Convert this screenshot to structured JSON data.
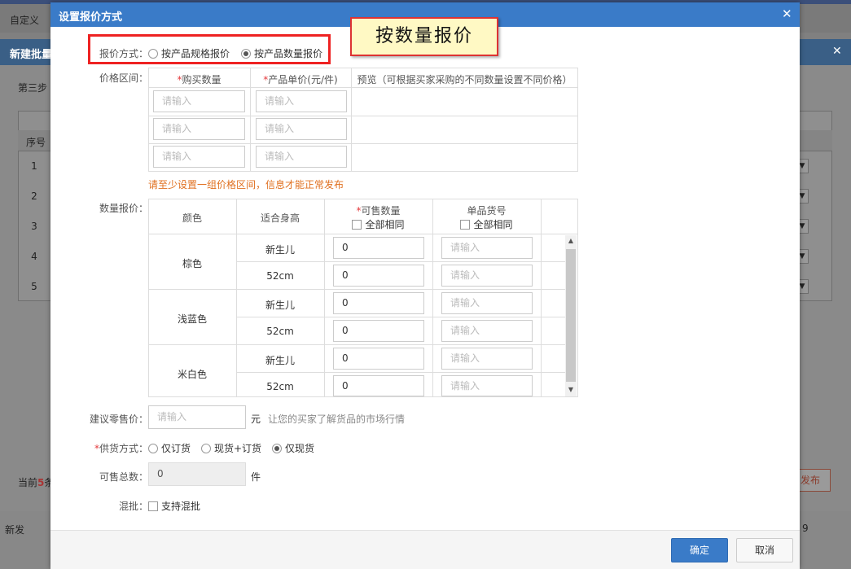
{
  "background": {
    "tab_text": "自定义",
    "panel_title": "新建批量",
    "step_text": "第三步",
    "col_index": "序号",
    "rows": [
      "1",
      "2",
      "3",
      "4",
      "5"
    ],
    "count_prefix": "当前",
    "count_value": "5",
    "count_suffix": "条",
    "publish": "发布",
    "footer_text": "新发",
    "footer_num": "9"
  },
  "modal": {
    "title": "设置报价方式",
    "close_icon": "close-icon",
    "annotation": "按数量报价",
    "pricing_mode": {
      "label": "报价方式：",
      "option_spec": "按产品规格报价",
      "option_qty": "按产品数量报价",
      "selected": "option_qty"
    },
    "price_range": {
      "label": "价格区间：",
      "col_qty": "购买数量",
      "col_price": "产品单价(元/件)",
      "col_preview": "预览（可根据买家采购的不同数量设置不同价格）",
      "placeholder": "请输入",
      "hint": "请至少设置一组价格区间，信息才能正常发布"
    },
    "qty_pricing": {
      "label": "数量报价：",
      "col_color": "颜色",
      "col_height": "适合身高",
      "col_stock": "可售数量",
      "col_sku": "单品货号",
      "all_same": "全部相同",
      "stock_value": "0",
      "sku_placeholder": "请输入",
      "colors": [
        "棕色",
        "浅蓝色",
        "米白色"
      ],
      "sizes": [
        "新生儿",
        "52cm"
      ]
    },
    "retail": {
      "label": "建议零售价：",
      "placeholder": "请输入",
      "unit": "元",
      "hint": "让您的买家了解货品的市场行情"
    },
    "supply": {
      "label": "供货方式：",
      "opt1": "仅订货",
      "opt2": "现货+订货",
      "opt3": "仅现货",
      "selected": "opt3"
    },
    "total": {
      "label": "可售总数：",
      "value": "0",
      "unit": "件"
    },
    "mixed": {
      "label": "混批：",
      "option": "支持混批"
    },
    "ok": "确定",
    "cancel": "取消"
  }
}
